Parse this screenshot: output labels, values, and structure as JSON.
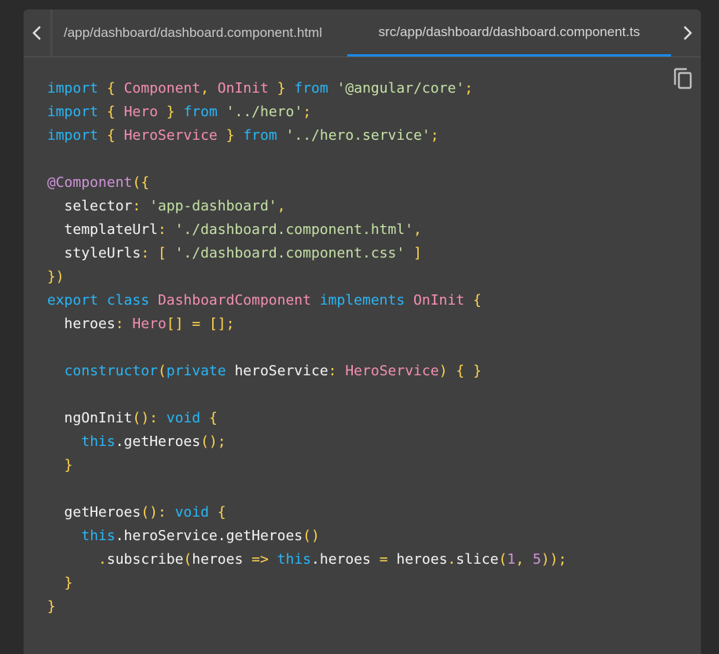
{
  "tabs": [
    {
      "label": "/app/dashboard/dashboard.component.html"
    },
    {
      "label": "src/app/dashboard/dashboard.component.ts"
    }
  ],
  "icons": {
    "prev": "chevron-left-icon",
    "next": "chevron-right-icon",
    "copy": "copy-icon"
  },
  "colors": {
    "panel": "#404040",
    "active_tab_underline": "#1e88e5",
    "keyword": "#29b6f6",
    "identifier": "#f48fb1",
    "string": "#c5e1a5",
    "punctuation": "#ffd54f",
    "decorator": "#ce93d8"
  },
  "code": [
    [
      [
        "kw",
        "import"
      ],
      [
        "txt",
        " "
      ],
      [
        "pun",
        "{"
      ],
      [
        "txt",
        " "
      ],
      [
        "id",
        "Component"
      ],
      [
        "pun",
        ","
      ],
      [
        "txt",
        " "
      ],
      [
        "id",
        "OnInit"
      ],
      [
        "txt",
        " "
      ],
      [
        "pun",
        "}"
      ],
      [
        "txt",
        " "
      ],
      [
        "kw",
        "from"
      ],
      [
        "txt",
        " "
      ],
      [
        "str",
        "'@angular/core'"
      ],
      [
        "pun",
        ";"
      ]
    ],
    [
      [
        "kw",
        "import"
      ],
      [
        "txt",
        " "
      ],
      [
        "pun",
        "{"
      ],
      [
        "txt",
        " "
      ],
      [
        "id",
        "Hero"
      ],
      [
        "txt",
        " "
      ],
      [
        "pun",
        "}"
      ],
      [
        "txt",
        " "
      ],
      [
        "kw",
        "from"
      ],
      [
        "txt",
        " "
      ],
      [
        "str",
        "'../hero'"
      ],
      [
        "pun",
        ";"
      ]
    ],
    [
      [
        "kw",
        "import"
      ],
      [
        "txt",
        " "
      ],
      [
        "pun",
        "{"
      ],
      [
        "txt",
        " "
      ],
      [
        "id",
        "HeroService"
      ],
      [
        "txt",
        " "
      ],
      [
        "pun",
        "}"
      ],
      [
        "txt",
        " "
      ],
      [
        "kw",
        "from"
      ],
      [
        "txt",
        " "
      ],
      [
        "str",
        "'../hero.service'"
      ],
      [
        "pun",
        ";"
      ]
    ],
    [],
    [
      [
        "dec",
        "@Component"
      ],
      [
        "pun",
        "({"
      ]
    ],
    [
      [
        "txt",
        "  selector"
      ],
      [
        "pun",
        ":"
      ],
      [
        "txt",
        " "
      ],
      [
        "str",
        "'app-dashboard'"
      ],
      [
        "pun",
        ","
      ]
    ],
    [
      [
        "txt",
        "  templateUrl"
      ],
      [
        "pun",
        ":"
      ],
      [
        "txt",
        " "
      ],
      [
        "str",
        "'./dashboard.component.html'"
      ],
      [
        "pun",
        ","
      ]
    ],
    [
      [
        "txt",
        "  styleUrls"
      ],
      [
        "pun",
        ":"
      ],
      [
        "txt",
        " "
      ],
      [
        "pun",
        "["
      ],
      [
        "txt",
        " "
      ],
      [
        "str",
        "'./dashboard.component.css'"
      ],
      [
        "txt",
        " "
      ],
      [
        "pun",
        "]"
      ]
    ],
    [
      [
        "pun",
        "})"
      ]
    ],
    [
      [
        "kw",
        "export"
      ],
      [
        "txt",
        " "
      ],
      [
        "kw",
        "class"
      ],
      [
        "txt",
        " "
      ],
      [
        "id",
        "DashboardComponent"
      ],
      [
        "txt",
        " "
      ],
      [
        "kw",
        "implements"
      ],
      [
        "txt",
        " "
      ],
      [
        "id",
        "OnInit"
      ],
      [
        "txt",
        " "
      ],
      [
        "pun",
        "{"
      ]
    ],
    [
      [
        "txt",
        "  heroes"
      ],
      [
        "pun",
        ":"
      ],
      [
        "txt",
        " "
      ],
      [
        "id",
        "Hero"
      ],
      [
        "pun",
        "[]"
      ],
      [
        "txt",
        " "
      ],
      [
        "pun",
        "="
      ],
      [
        "txt",
        " "
      ],
      [
        "pun",
        "[];"
      ]
    ],
    [],
    [
      [
        "txt",
        "  "
      ],
      [
        "kw",
        "constructor"
      ],
      [
        "pun",
        "("
      ],
      [
        "kw",
        "private"
      ],
      [
        "txt",
        " heroService"
      ],
      [
        "pun",
        ":"
      ],
      [
        "txt",
        " "
      ],
      [
        "id",
        "HeroService"
      ],
      [
        "pun",
        ")"
      ],
      [
        "txt",
        " "
      ],
      [
        "pun",
        "{"
      ],
      [
        "txt",
        " "
      ],
      [
        "pun",
        "}"
      ]
    ],
    [],
    [
      [
        "txt",
        "  ngOnInit"
      ],
      [
        "pun",
        "():"
      ],
      [
        "txt",
        " "
      ],
      [
        "kw",
        "void"
      ],
      [
        "txt",
        " "
      ],
      [
        "pun",
        "{"
      ]
    ],
    [
      [
        "txt",
        "    "
      ],
      [
        "kw",
        "this"
      ],
      [
        "txt",
        ".getHeroes"
      ],
      [
        "pun",
        "();"
      ]
    ],
    [
      [
        "txt",
        "  "
      ],
      [
        "pun",
        "}"
      ]
    ],
    [],
    [
      [
        "txt",
        "  getHeroes"
      ],
      [
        "pun",
        "():"
      ],
      [
        "txt",
        " "
      ],
      [
        "kw",
        "void"
      ],
      [
        "txt",
        " "
      ],
      [
        "pun",
        "{"
      ]
    ],
    [
      [
        "txt",
        "    "
      ],
      [
        "kw",
        "this"
      ],
      [
        "txt",
        ".heroService.getHeroes"
      ],
      [
        "pun",
        "()"
      ]
    ],
    [
      [
        "txt",
        "      "
      ],
      [
        "pun",
        "."
      ],
      [
        "txt",
        "subscribe"
      ],
      [
        "pun",
        "("
      ],
      [
        "txt",
        "heroes "
      ],
      [
        "pun",
        "=>"
      ],
      [
        "txt",
        " "
      ],
      [
        "kw",
        "this"
      ],
      [
        "txt",
        ".heroes "
      ],
      [
        "pun",
        "="
      ],
      [
        "txt",
        " heroes"
      ],
      [
        "pun",
        "."
      ],
      [
        "txt",
        "slice"
      ],
      [
        "pun",
        "("
      ],
      [
        "num",
        "1"
      ],
      [
        "pun",
        ","
      ],
      [
        "txt",
        " "
      ],
      [
        "num",
        "5"
      ],
      [
        "pun",
        "));"
      ]
    ],
    [
      [
        "txt",
        "  "
      ],
      [
        "pun",
        "}"
      ]
    ],
    [
      [
        "pun",
        "}"
      ]
    ]
  ]
}
